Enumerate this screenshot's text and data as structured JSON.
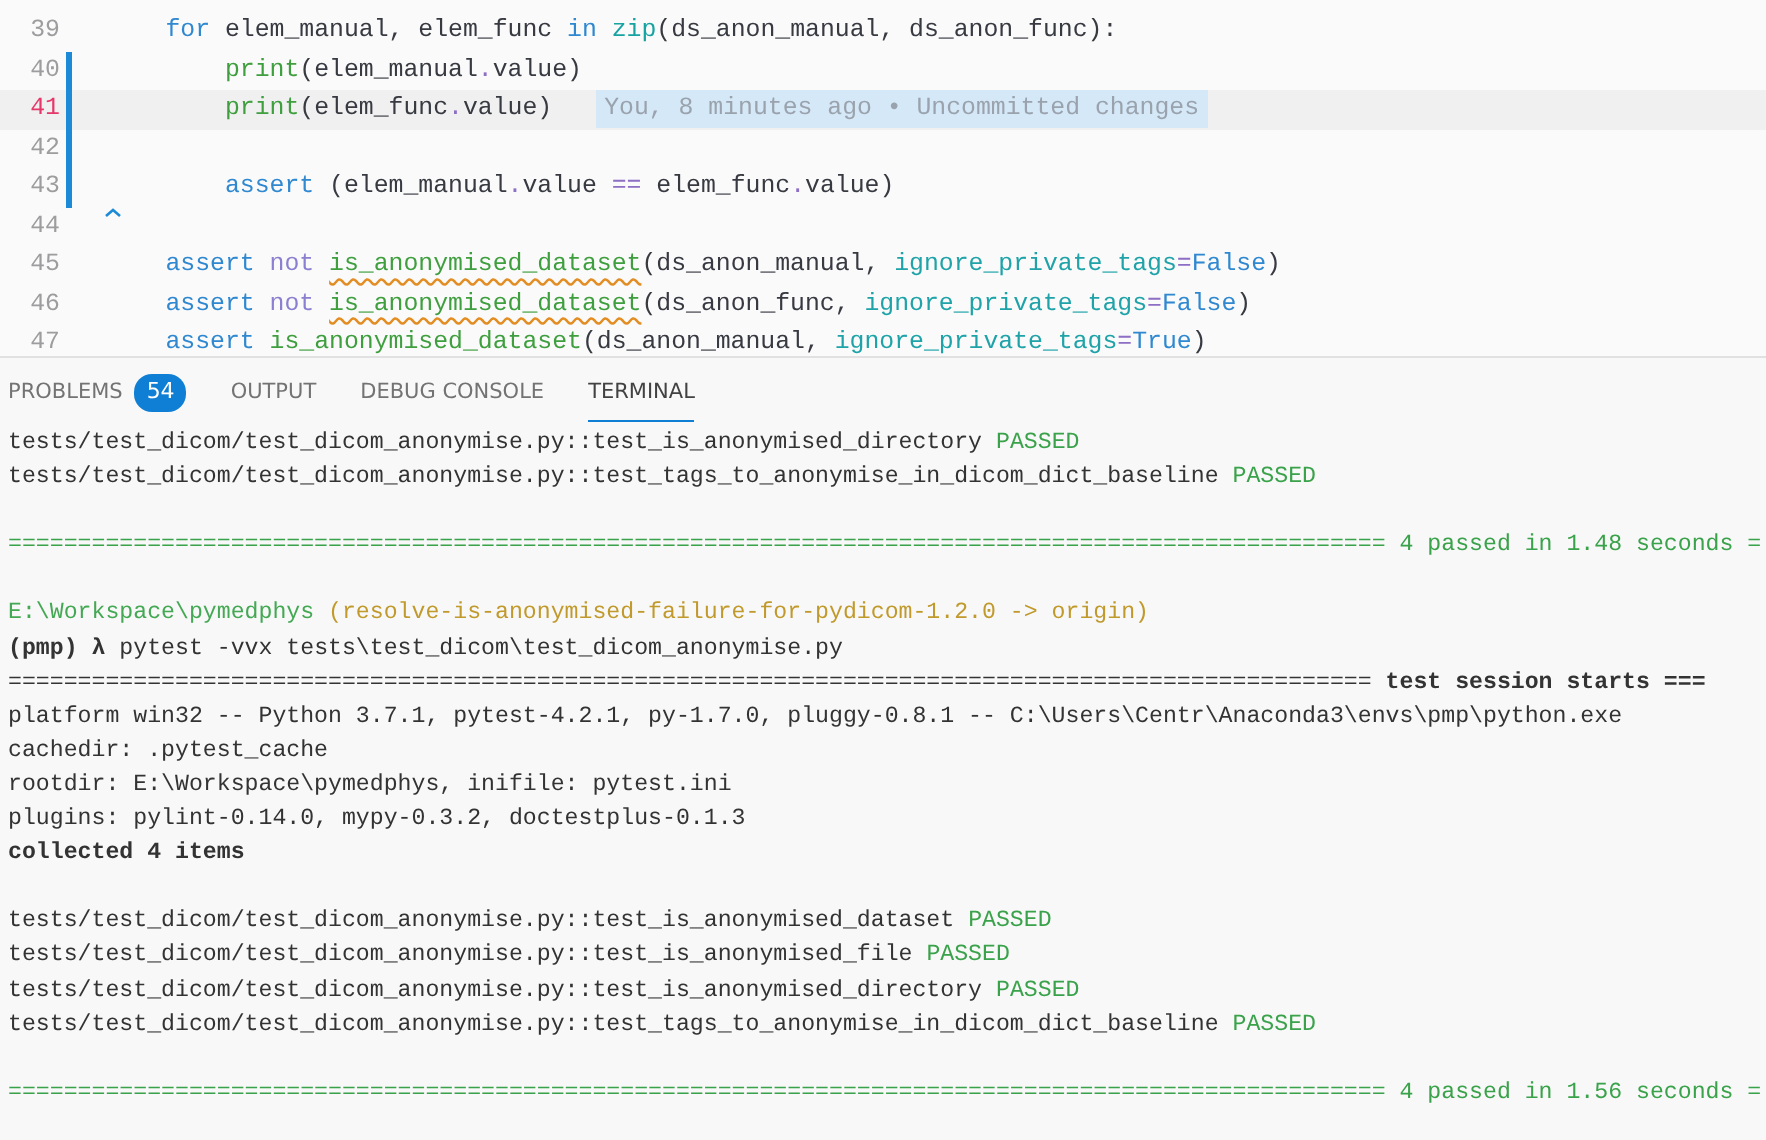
{
  "editor": {
    "lines": [
      {
        "number": "39",
        "modified": false,
        "current": false,
        "tokens": [
          {
            "text": "    for ",
            "kind": "kw"
          },
          {
            "text": "elem_manual, elem_func "
          },
          {
            "text": "in ",
            "kind": "kw"
          },
          {
            "text": "zip",
            "kind": "builtin"
          },
          {
            "text": "(ds_anon_manual, ds_anon_func):"
          }
        ]
      },
      {
        "number": "40",
        "modified": true,
        "current": false,
        "tokens": [
          {
            "text": "        print",
            "kind": "fn"
          },
          {
            "text": "(elem_manual"
          },
          {
            "text": ".",
            "kind": "op"
          },
          {
            "text": "value)"
          }
        ]
      },
      {
        "number": "41",
        "modified": true,
        "current": true,
        "blame": "You, 8 minutes ago • Uncommitted changes",
        "tokens": [
          {
            "text": "        print",
            "kind": "fn"
          },
          {
            "text": "(elem_func"
          },
          {
            "text": ".",
            "kind": "op"
          },
          {
            "text": "value)"
          }
        ]
      },
      {
        "number": "42",
        "modified": true,
        "current": false
      },
      {
        "number": "43",
        "modified": true,
        "current": false,
        "tokens": [
          {
            "text": "        assert ",
            "kind": "kw"
          },
          {
            "text": "(elem_manual"
          },
          {
            "text": ".",
            "kind": "op"
          },
          {
            "text": "value "
          },
          {
            "text": "==",
            "kind": "op"
          },
          {
            "text": " elem_func"
          },
          {
            "text": ".",
            "kind": "op"
          },
          {
            "text": "value)"
          }
        ]
      },
      {
        "number": "44",
        "modified": false,
        "current": false,
        "deleted_marker": true
      },
      {
        "number": "45",
        "modified": false,
        "current": false,
        "tokens": [
          {
            "text": "    assert ",
            "kind": "kw"
          },
          {
            "text": "not ",
            "kind": "not"
          },
          {
            "text": "is_anonymised_dataset",
            "kind": "warn"
          },
          {
            "text": "(ds_anon_manual, "
          },
          {
            "text": "ignore_private_tags",
            "kind": "param"
          },
          {
            "text": "=",
            "kind": "op"
          },
          {
            "text": "False",
            "kind": "kw"
          },
          {
            "text": ")"
          }
        ]
      },
      {
        "number": "46",
        "modified": false,
        "current": false,
        "tokens": [
          {
            "text": "    assert ",
            "kind": "kw"
          },
          {
            "text": "not ",
            "kind": "not"
          },
          {
            "text": "is_anonymised_dataset",
            "kind": "warn"
          },
          {
            "text": "(ds_anon_func, "
          },
          {
            "text": "ignore_private_tags",
            "kind": "param"
          },
          {
            "text": "=",
            "kind": "op"
          },
          {
            "text": "False",
            "kind": "kw"
          },
          {
            "text": ")"
          }
        ]
      },
      {
        "number": "47",
        "modified": false,
        "current": false,
        "tokens": [
          {
            "text": "    assert ",
            "kind": "kw"
          },
          {
            "text": "is_anonymised_dataset",
            "kind": "warn"
          },
          {
            "text": "(ds_anon_manual, "
          },
          {
            "text": "ignore_private_tags",
            "kind": "param"
          },
          {
            "text": "=",
            "kind": "op"
          },
          {
            "text": "True",
            "kind": "kw"
          },
          {
            "text": ")"
          }
        ]
      }
    ]
  },
  "panel_tabs": [
    {
      "label": "PROBLEMS",
      "badge": "54",
      "selected": false
    },
    {
      "label": "OUTPUT",
      "selected": false
    },
    {
      "label": "DEBUG CONSOLE",
      "selected": false
    },
    {
      "label": "TERMINAL",
      "selected": true
    }
  ],
  "terminal": {
    "lines": [
      {
        "segments": [
          {
            "text": "tests/test_dicom/test_dicom_anonymise.py::test_is_anonymised_directory "
          },
          {
            "text": "PASSED",
            "kind": "pass"
          }
        ]
      },
      {
        "segments": [
          {
            "text": "tests/test_dicom/test_dicom_anonymise.py::test_tags_to_anonymise_in_dicom_dict_baseline "
          },
          {
            "text": "PASSED",
            "kind": "pass"
          }
        ]
      },
      {
        "kind": "blank"
      },
      {
        "segments": [
          {
            "text": "=================================================================================================== 4 passed in 1.48 seconds =",
            "kind": "pass"
          }
        ]
      },
      {
        "kind": "blank"
      },
      {
        "segments": [
          {
            "text": "E:\\Workspace\\pymedphys",
            "kind": "path"
          },
          {
            "text": " (resolve-is-anonymised-failure-for-pydicom-1.2.0 -> origin)",
            "kind": "branch"
          }
        ]
      },
      {
        "segments": [
          {
            "text": "(pmp) λ",
            "kind": "bold"
          },
          {
            "text": " pytest -vvx tests\\test_dicom\\test_dicom_anonymise.py"
          }
        ]
      },
      {
        "segments": [
          {
            "text": "================================================================================================== "
          },
          {
            "text": "test session starts ===",
            "kind": "bold"
          }
        ]
      },
      {
        "segments": [
          {
            "text": "platform win32 -- Python 3.7.1, pytest-4.2.1, py-1.7.0, pluggy-0.8.1 -- C:\\Users\\Centr\\Anaconda3\\envs\\pmp\\python.exe"
          }
        ]
      },
      {
        "segments": [
          {
            "text": "cachedir: .pytest_cache"
          }
        ]
      },
      {
        "segments": [
          {
            "text": "rootdir: E:\\Workspace\\pymedphys, inifile: pytest.ini"
          }
        ]
      },
      {
        "segments": [
          {
            "text": "plugins: pylint-0.14.0, mypy-0.3.2, doctestplus-0.1.3"
          }
        ]
      },
      {
        "segments": [
          {
            "text": "collected 4 items",
            "kind": "bold"
          }
        ]
      },
      {
        "kind": "blank"
      },
      {
        "segments": [
          {
            "text": "tests/test_dicom/test_dicom_anonymise.py::test_is_anonymised_dataset "
          },
          {
            "text": "PASSED",
            "kind": "pass"
          }
        ]
      },
      {
        "segments": [
          {
            "text": "tests/test_dicom/test_dicom_anonymise.py::test_is_anonymised_file "
          },
          {
            "text": "PASSED",
            "kind": "pass"
          }
        ]
      },
      {
        "segments": [
          {
            "text": "tests/test_dicom/test_dicom_anonymise.py::test_is_anonymised_directory "
          },
          {
            "text": "PASSED",
            "kind": "pass"
          }
        ]
      },
      {
        "segments": [
          {
            "text": "tests/test_dicom/test_dicom_anonymise.py::test_tags_to_anonymise_in_dicom_dict_baseline "
          },
          {
            "text": "PASSED",
            "kind": "pass"
          }
        ]
      },
      {
        "kind": "blank"
      },
      {
        "segments": [
          {
            "text": "=================================================================================================== 4 passed in 1.56 seconds =",
            "kind": "pass"
          }
        ]
      }
    ]
  }
}
